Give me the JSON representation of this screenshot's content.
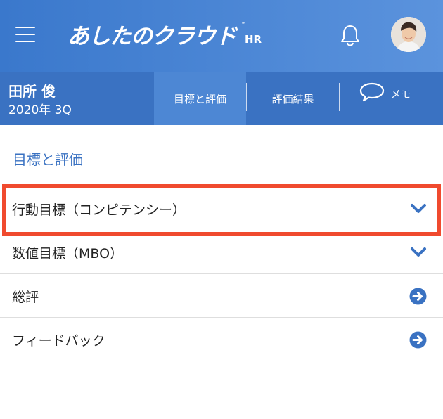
{
  "header": {
    "logo_text": "あしたのクラウド",
    "logo_sub": "HR",
    "logo_tm": "™",
    "icons": {
      "menu": "hamburger-icon",
      "notifications": "bell-icon",
      "avatar": "user-avatar"
    }
  },
  "user": {
    "name": "田所 俊",
    "period": "2020年 3Q"
  },
  "tabs": [
    {
      "label": "目標と評価",
      "active": true
    },
    {
      "label": "評価結果",
      "active": false
    },
    {
      "label": "メモ",
      "icon": "speech-bubble-icon",
      "active": false
    }
  ],
  "main": {
    "section_title": "目標と評価",
    "items": [
      {
        "label": "行動目標（コンピテンシー）",
        "icon": "chevron-down-icon",
        "highlighted": true
      },
      {
        "label": "数値目標（MBO）",
        "icon": "chevron-down-icon",
        "highlighted": false
      },
      {
        "label": "総評",
        "icon": "arrow-right-circle-icon",
        "highlighted": false
      },
      {
        "label": "フィードバック",
        "icon": "arrow-right-circle-icon",
        "highlighted": false
      }
    ]
  },
  "colors": {
    "header_gradient_start": "#3a78cc",
    "header_gradient_end": "#5b93dd",
    "subbar": "#3a72c2",
    "active_tab": "#4d87d4",
    "accent": "#3a72c2",
    "highlight_border": "#f04a2e"
  }
}
